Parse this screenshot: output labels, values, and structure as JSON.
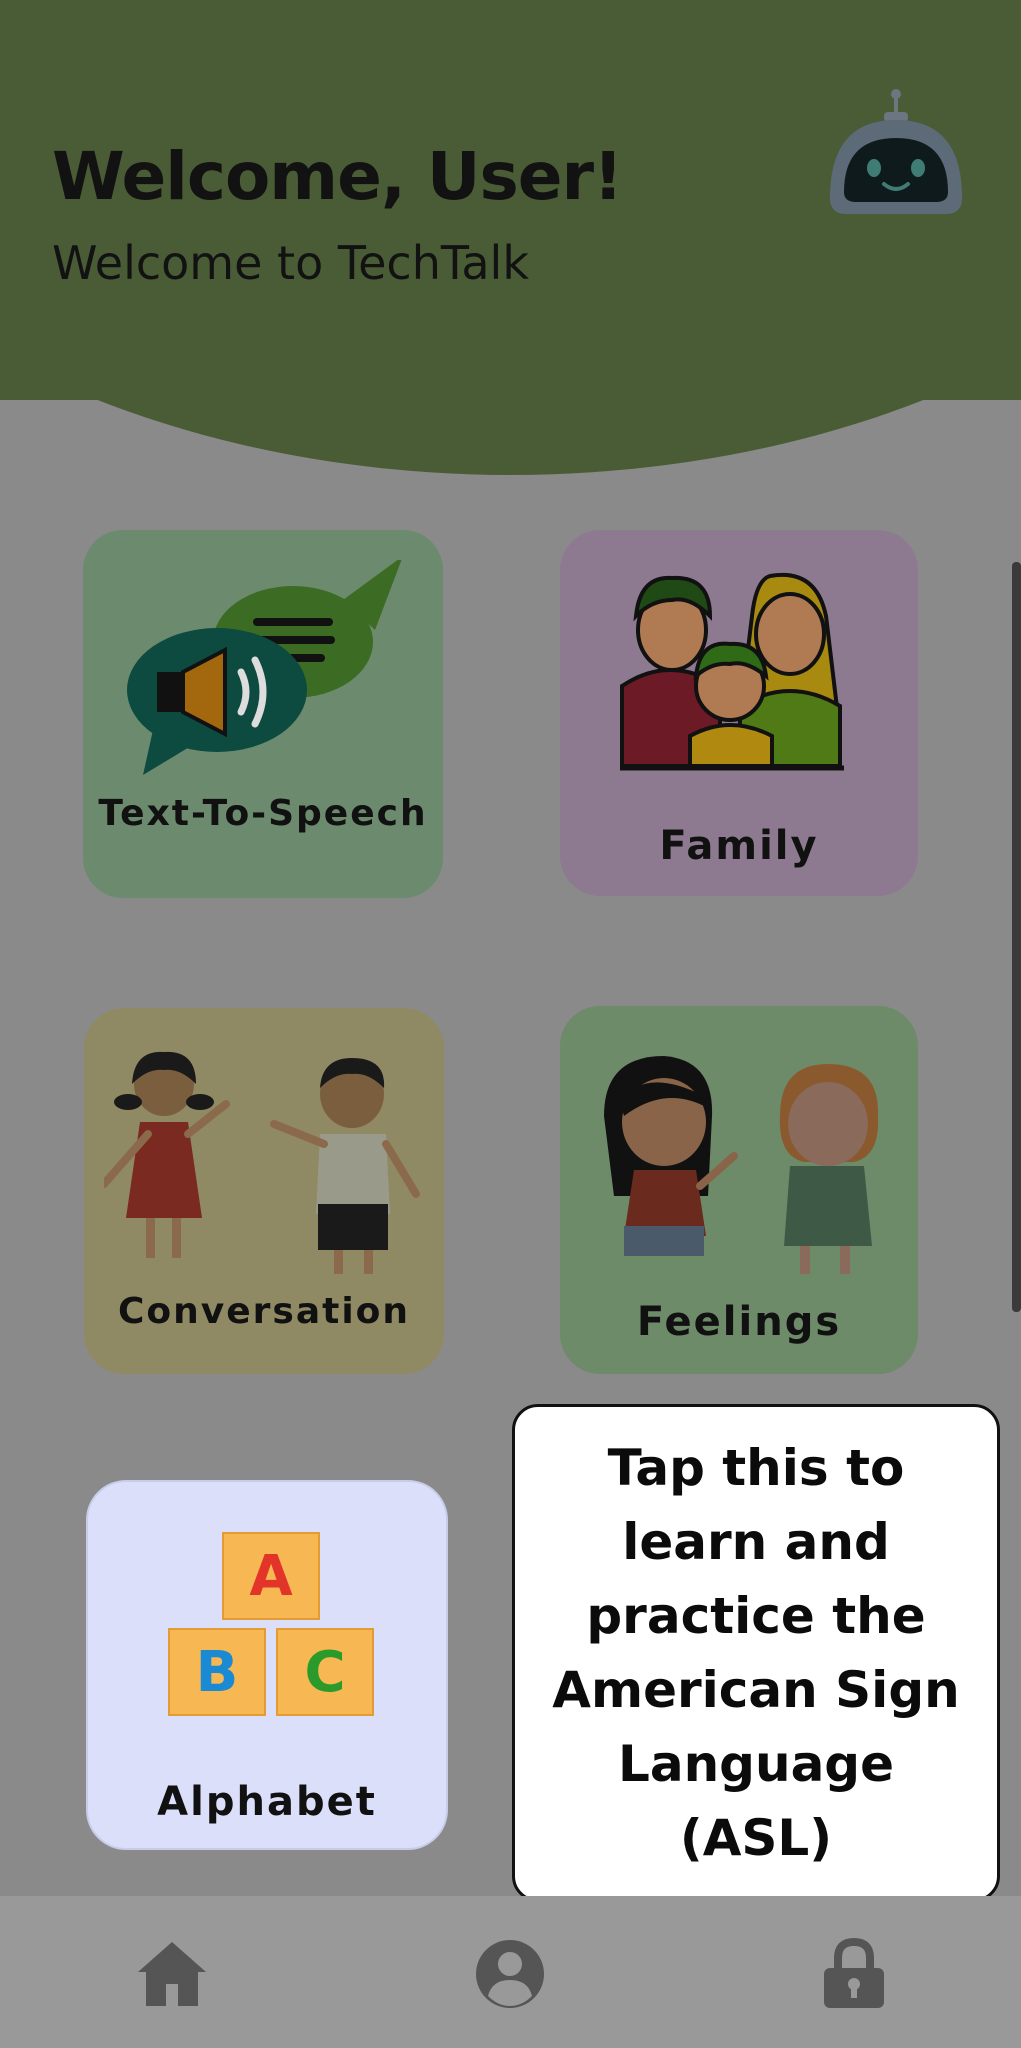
{
  "header": {
    "title": "Welcome, User!",
    "subtitle": "Welcome to TechTalk",
    "mascot_icon": "robot-icon",
    "background_color": "#4a5c36"
  },
  "tiles": [
    {
      "label": "Text-To-Speech",
      "icon": "speech-bubbles-speaker-icon"
    },
    {
      "label": "Family",
      "icon": "family-icon"
    },
    {
      "label": "Conversation",
      "icon": "kids-waving-icon"
    },
    {
      "label": "Feelings",
      "icon": "kids-laughing-icon"
    },
    {
      "label": "Alphabet",
      "icon": "abc-blocks-icon",
      "blocks": [
        "A",
        "B",
        "C"
      ]
    }
  ],
  "tooltip": {
    "text": "Tap this to learn and practice the American Sign Language (ASL)"
  },
  "bottom_nav": {
    "items": [
      {
        "icon": "home-icon"
      },
      {
        "icon": "profile-icon"
      },
      {
        "icon": "lock-icon"
      }
    ]
  }
}
